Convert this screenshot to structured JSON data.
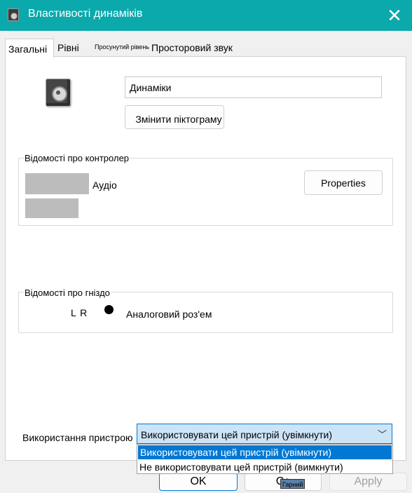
{
  "window": {
    "title": "Властивості динаміків",
    "close_glyph": "✕",
    "icon": "speaker-icon"
  },
  "tabs": [
    {
      "label": "Загальні",
      "active": true
    },
    {
      "label": "Рівні"
    },
    {
      "label": "Просунутий рівень"
    },
    {
      "label": "Просторовий звук"
    }
  ],
  "general": {
    "device_name_value": "Динаміки",
    "change_icon_label": "Змінити піктограму",
    "controller": {
      "title": "Відомості про контролер",
      "audio_label": "Аудіо",
      "properties_label": "Properties"
    },
    "jack": {
      "title": "Відомості про гніздо",
      "lr_label": "L R",
      "connector_label": "Аналоговий роз'ем"
    },
    "usage": {
      "label": "Використання пристрою",
      "selected": "Використовувати цей пристрій (увімкнути)",
      "options": [
        "Використовувати цей пристрій (увімкнути)",
        "Не використовувати цей пристрій (вимкнути)"
      ]
    }
  },
  "footer": {
    "ok_label": "OK",
    "cancel_label": "Ca",
    "apply_label": "Apply",
    "tooltip": "Гарний"
  }
}
